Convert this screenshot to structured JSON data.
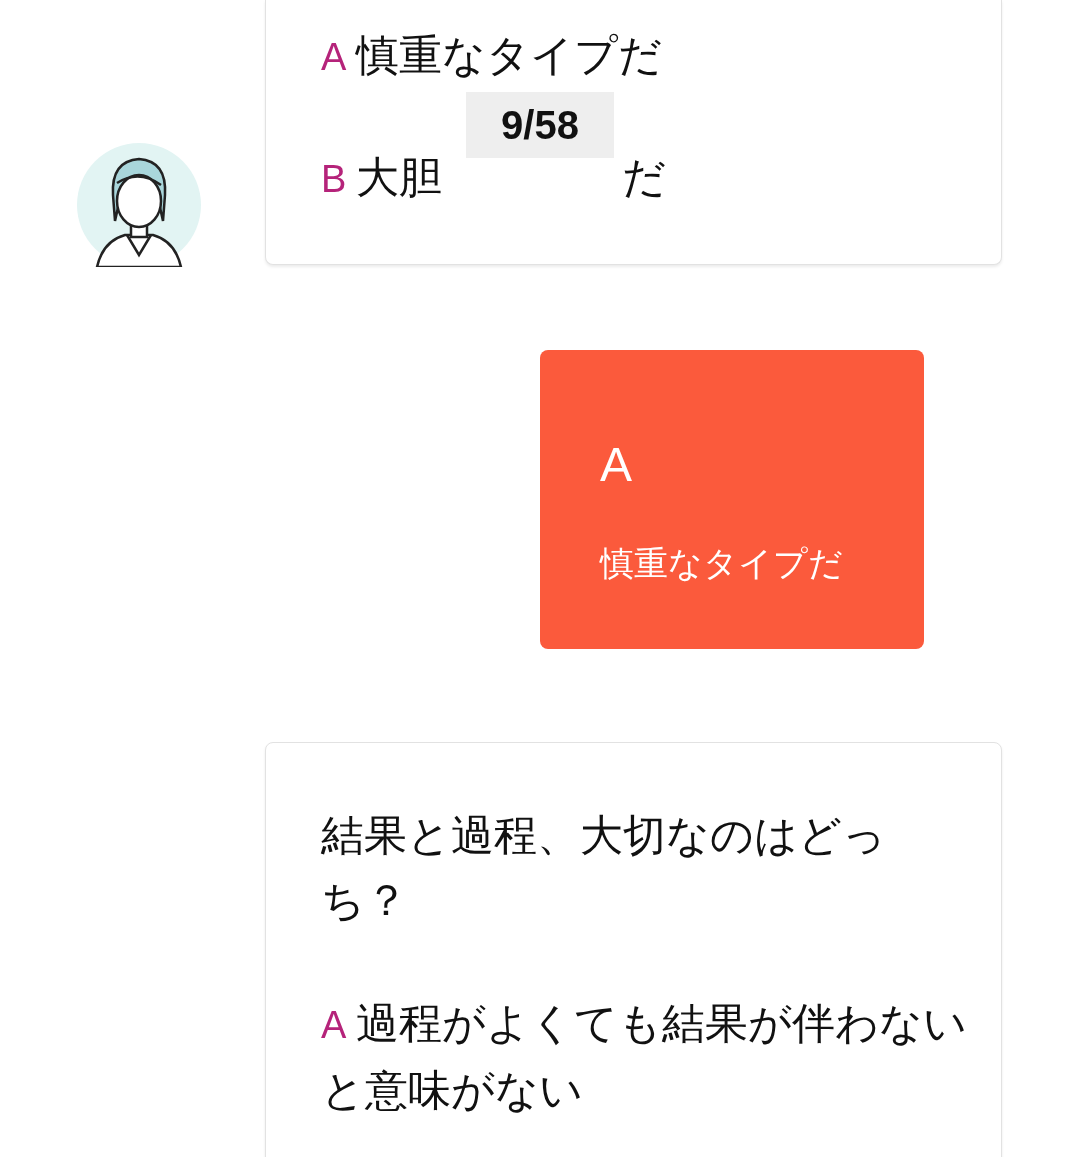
{
  "thread": [
    {
      "kind": "question",
      "avatar": true,
      "options": [
        {
          "label": "A",
          "text": "慎重なタイプだ"
        },
        {
          "label": "B",
          "text": "大胆",
          "text_tail": "だ"
        }
      ],
      "page_counter": "9/58"
    },
    {
      "kind": "answer",
      "choice": "A",
      "text": "慎重なタイプだ"
    },
    {
      "kind": "question",
      "avatar": false,
      "question": "結果と過程、大切なのはどっち？",
      "options": [
        {
          "label": "A",
          "text": "過程がよくても結果が伴わないと意味がない"
        }
      ]
    }
  ]
}
